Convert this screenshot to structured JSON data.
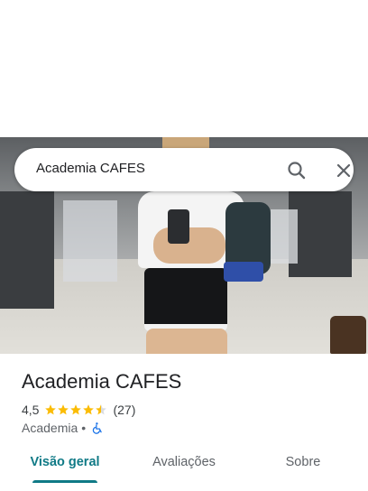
{
  "search": {
    "query": "Academia CAFES",
    "search_icon": "search-icon",
    "close_icon": "close-icon"
  },
  "hero": {
    "image": "gym-photo"
  },
  "place": {
    "title": "Academia CAFES",
    "rating": "4,5",
    "stars": 4.5,
    "review_count": "(27)",
    "category": "Academia",
    "separator": "•",
    "accessibility_icon": "wheelchair-icon"
  },
  "tabs": [
    {
      "label": "Visão geral",
      "active": true
    },
    {
      "label": "Avaliações",
      "active": false
    },
    {
      "label": "Sobre",
      "active": false
    }
  ],
  "colors": {
    "accent": "#107a86",
    "star": "#fbbc04",
    "accessibility": "#1a73e8"
  }
}
